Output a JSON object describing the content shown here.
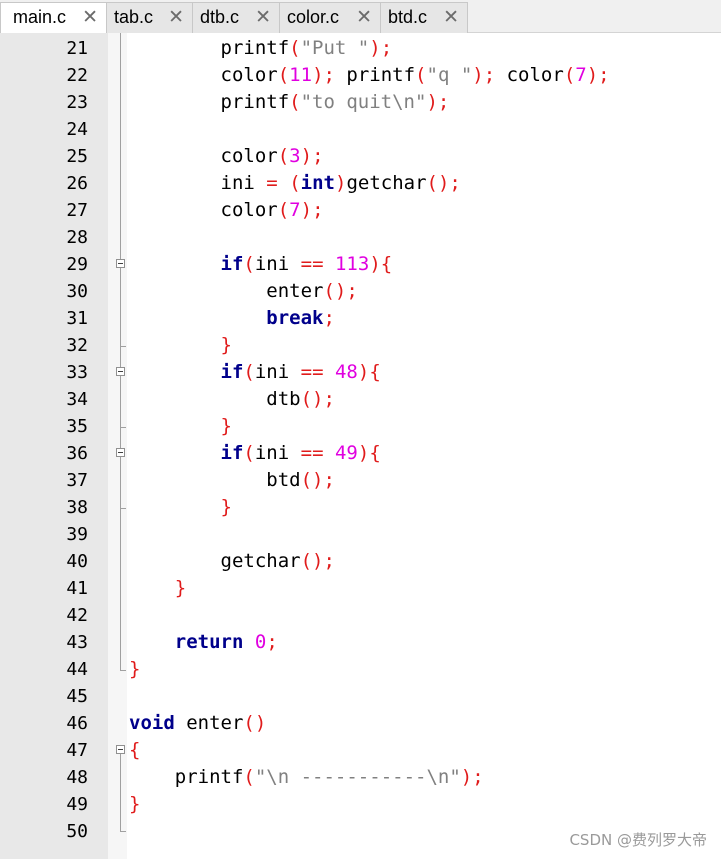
{
  "tabs": [
    {
      "label": "main.c",
      "active": true
    },
    {
      "label": "tab.c",
      "active": false
    },
    {
      "label": "dtb.c",
      "active": false
    },
    {
      "label": "color.c",
      "active": false
    },
    {
      "label": "btd.c",
      "active": false
    }
  ],
  "close_glyph": "✕",
  "colors": {
    "keyword": "#00008b",
    "operator": "#e01b1b",
    "number": "#e000e0",
    "string": "#808080"
  },
  "lines": [
    {
      "n": "21",
      "tokens": [
        [
          "",
          "        "
        ],
        [
          "fn",
          "printf"
        ],
        [
          "op",
          "("
        ],
        [
          "str",
          "\"Put \""
        ],
        [
          "op",
          ");"
        ]
      ]
    },
    {
      "n": "22",
      "tokens": [
        [
          "",
          "        "
        ],
        [
          "fn",
          "color"
        ],
        [
          "op",
          "("
        ],
        [
          "num",
          "11"
        ],
        [
          "op",
          ");"
        ],
        [
          "",
          " "
        ],
        [
          "fn",
          "printf"
        ],
        [
          "op",
          "("
        ],
        [
          "str",
          "\"q \""
        ],
        [
          "op",
          ");"
        ],
        [
          "",
          " "
        ],
        [
          "fn",
          "color"
        ],
        [
          "op",
          "("
        ],
        [
          "num",
          "7"
        ],
        [
          "op",
          ");"
        ]
      ]
    },
    {
      "n": "23",
      "tokens": [
        [
          "",
          "        "
        ],
        [
          "fn",
          "printf"
        ],
        [
          "op",
          "("
        ],
        [
          "str",
          "\"to quit\\n\""
        ],
        [
          "op",
          ");"
        ]
      ]
    },
    {
      "n": "24",
      "tokens": []
    },
    {
      "n": "25",
      "tokens": [
        [
          "",
          "        "
        ],
        [
          "fn",
          "color"
        ],
        [
          "op",
          "("
        ],
        [
          "num",
          "3"
        ],
        [
          "op",
          ");"
        ]
      ]
    },
    {
      "n": "26",
      "tokens": [
        [
          "",
          "        "
        ],
        [
          "fn",
          "ini"
        ],
        [
          "",
          " "
        ],
        [
          "op",
          "="
        ],
        [
          "",
          " "
        ],
        [
          "op",
          "("
        ],
        [
          "kw",
          "int"
        ],
        [
          "op",
          ")"
        ],
        [
          "fn",
          "getchar"
        ],
        [
          "op",
          "();"
        ]
      ]
    },
    {
      "n": "27",
      "tokens": [
        [
          "",
          "        "
        ],
        [
          "fn",
          "color"
        ],
        [
          "op",
          "("
        ],
        [
          "num",
          "7"
        ],
        [
          "op",
          ");"
        ]
      ]
    },
    {
      "n": "28",
      "tokens": []
    },
    {
      "n": "29",
      "tokens": [
        [
          "",
          "        "
        ],
        [
          "kw",
          "if"
        ],
        [
          "op",
          "("
        ],
        [
          "fn",
          "ini"
        ],
        [
          "",
          " "
        ],
        [
          "op",
          "=="
        ],
        [
          "",
          " "
        ],
        [
          "num",
          "113"
        ],
        [
          "op",
          "){"
        ]
      ]
    },
    {
      "n": "30",
      "tokens": [
        [
          "",
          "            "
        ],
        [
          "fn",
          "enter"
        ],
        [
          "op",
          "();"
        ]
      ]
    },
    {
      "n": "31",
      "tokens": [
        [
          "",
          "            "
        ],
        [
          "kw",
          "break"
        ],
        [
          "op",
          ";"
        ]
      ]
    },
    {
      "n": "32",
      "tokens": [
        [
          "",
          "        "
        ],
        [
          "op",
          "}"
        ]
      ]
    },
    {
      "n": "33",
      "tokens": [
        [
          "",
          "        "
        ],
        [
          "kw",
          "if"
        ],
        [
          "op",
          "("
        ],
        [
          "fn",
          "ini"
        ],
        [
          "",
          " "
        ],
        [
          "op",
          "=="
        ],
        [
          "",
          " "
        ],
        [
          "num",
          "48"
        ],
        [
          "op",
          "){"
        ]
      ]
    },
    {
      "n": "34",
      "tokens": [
        [
          "",
          "            "
        ],
        [
          "fn",
          "dtb"
        ],
        [
          "op",
          "();"
        ]
      ]
    },
    {
      "n": "35",
      "tokens": [
        [
          "",
          "        "
        ],
        [
          "op",
          "}"
        ]
      ]
    },
    {
      "n": "36",
      "tokens": [
        [
          "",
          "        "
        ],
        [
          "kw",
          "if"
        ],
        [
          "op",
          "("
        ],
        [
          "fn",
          "ini"
        ],
        [
          "",
          " "
        ],
        [
          "op",
          "=="
        ],
        [
          "",
          " "
        ],
        [
          "num",
          "49"
        ],
        [
          "op",
          "){"
        ]
      ]
    },
    {
      "n": "37",
      "tokens": [
        [
          "",
          "            "
        ],
        [
          "fn",
          "btd"
        ],
        [
          "op",
          "();"
        ]
      ]
    },
    {
      "n": "38",
      "tokens": [
        [
          "",
          "        "
        ],
        [
          "op",
          "}"
        ]
      ]
    },
    {
      "n": "39",
      "tokens": []
    },
    {
      "n": "40",
      "tokens": [
        [
          "",
          "        "
        ],
        [
          "fn",
          "getchar"
        ],
        [
          "op",
          "();"
        ]
      ]
    },
    {
      "n": "41",
      "tokens": [
        [
          "",
          "    "
        ],
        [
          "op",
          "}"
        ]
      ]
    },
    {
      "n": "42",
      "tokens": []
    },
    {
      "n": "43",
      "tokens": [
        [
          "",
          "    "
        ],
        [
          "kw",
          "return"
        ],
        [
          "",
          " "
        ],
        [
          "num",
          "0"
        ],
        [
          "op",
          ";"
        ]
      ]
    },
    {
      "n": "44",
      "tokens": [
        [
          "op",
          "}"
        ]
      ]
    },
    {
      "n": "45",
      "tokens": []
    },
    {
      "n": "46",
      "tokens": [
        [
          "kw",
          "void"
        ],
        [
          "",
          " "
        ],
        [
          "fn",
          "enter"
        ],
        [
          "op",
          "()"
        ]
      ]
    },
    {
      "n": "47",
      "tokens": [
        [
          "op",
          "{"
        ]
      ]
    },
    {
      "n": "48",
      "tokens": [
        [
          "",
          "    "
        ],
        [
          "fn",
          "printf"
        ],
        [
          "op",
          "("
        ],
        [
          "str",
          "\"\\n -----------\\n\""
        ],
        [
          "op",
          ");"
        ]
      ]
    },
    {
      "n": "49",
      "tokens": [
        [
          "op",
          "}"
        ]
      ]
    },
    {
      "n": "50",
      "tokens": []
    }
  ],
  "watermark": "CSDN @费列罗大帝"
}
